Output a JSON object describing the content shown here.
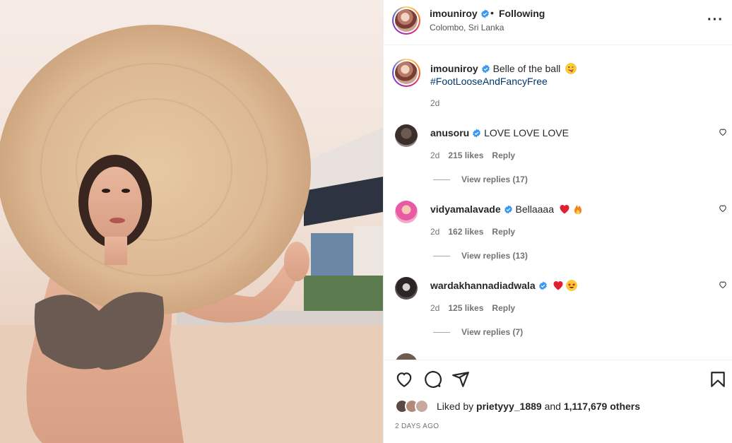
{
  "post": {
    "username": "imouniroy",
    "separator": "•",
    "follow_status": "Following",
    "location": "Colombo, Sri Lanka"
  },
  "caption": {
    "username": "imouniroy",
    "text": "Belle of the ball",
    "hashtag": "#FootLooseAndFancyFree",
    "age": "2d"
  },
  "comments": [
    {
      "username": "anusoru",
      "text": "LOVE LOVE LOVE",
      "emojis": [],
      "age": "2d",
      "likes": "215 likes",
      "reply_label": "Reply",
      "view_replies": "View replies (17)"
    },
    {
      "username": "vidyamalavade",
      "text": "Bellaaaa",
      "emojis": [
        "red-heart",
        "fire"
      ],
      "age": "2d",
      "likes": "162 likes",
      "reply_label": "Reply",
      "view_replies": "View replies (13)"
    },
    {
      "username": "wardakhannadiadwala",
      "text": "",
      "emojis": [
        "red-heart",
        "star-struck"
      ],
      "age": "2d",
      "likes": "125 likes",
      "reply_label": "Reply",
      "view_replies": "View replies (7)"
    }
  ],
  "likes": {
    "prefix": "Liked by",
    "user": "prietyyy_1889",
    "conjunction": "and",
    "count": "1,117,679 others"
  },
  "timestamp": "2 DAYS AGO",
  "icons": {
    "more": "more-options-icon",
    "like": "heart-icon",
    "comment": "comment-icon",
    "share": "share-icon",
    "save": "bookmark-icon",
    "verified": "verified-badge-icon"
  },
  "colors": {
    "verified": "#3897f0",
    "hashtag": "#00376b",
    "secondary_text": "#737373"
  }
}
